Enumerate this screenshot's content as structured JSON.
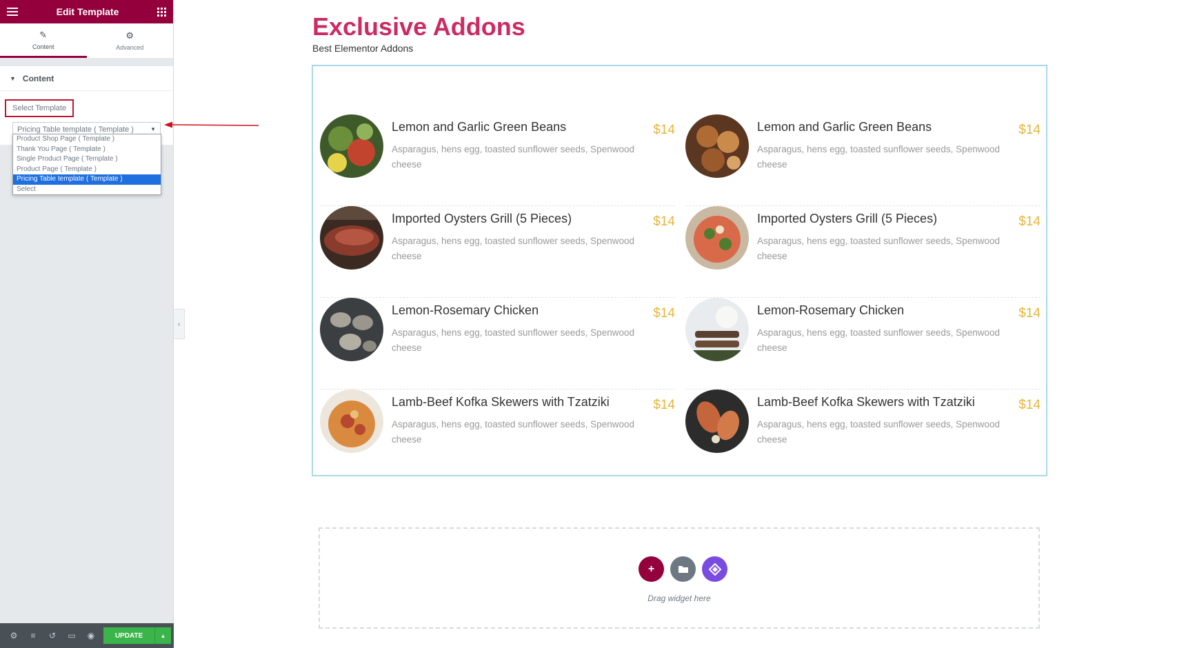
{
  "panel": {
    "title": "Edit Template",
    "tabs": [
      {
        "label": "Content",
        "icon": "pencil-icon"
      },
      {
        "label": "Advanced",
        "icon": "gear-icon"
      }
    ],
    "section_title": "Content",
    "control_label": "Select Template",
    "selected_value": "Pricing Table template ( Template )",
    "options": [
      "Product Shop Page ( Template )",
      "Thank You Page ( Template )",
      "Single Product Page ( Template )",
      "Product Page ( Template )",
      "Pricing Table template ( Template )",
      "Select"
    ],
    "footer": {
      "update_label": "UPDATE"
    }
  },
  "page": {
    "heading": "Exclusive Addons",
    "subheading": "Best Elementor Addons"
  },
  "menu": {
    "items": [
      {
        "title": "Lemon and Garlic Green Beans",
        "price": "$14",
        "desc": "Asparagus, hens egg, toasted sunflower seeds, Spenwood cheese"
      },
      {
        "title": "Lemon and Garlic Green Beans",
        "price": "$14",
        "desc": "Asparagus, hens egg, toasted sunflower seeds, Spenwood cheese"
      },
      {
        "title": "Imported Oysters Grill (5 Pieces)",
        "price": "$14",
        "desc": "Asparagus, hens egg, toasted sunflower seeds, Spenwood cheese"
      },
      {
        "title": "Imported Oysters Grill (5 Pieces)",
        "price": "$14",
        "desc": "Asparagus, hens egg, toasted sunflower seeds, Spenwood cheese"
      },
      {
        "title": "Lemon-Rosemary Chicken",
        "price": "$14",
        "desc": "Asparagus, hens egg, toasted sunflower seeds, Spenwood cheese"
      },
      {
        "title": "Lemon-Rosemary Chicken",
        "price": "$14",
        "desc": "Asparagus, hens egg, toasted sunflower seeds, Spenwood cheese"
      },
      {
        "title": "Lamb-Beef Kofka Skewers with Tzatziki",
        "price": "$14",
        "desc": "Asparagus, hens egg, toasted sunflower seeds, Spenwood cheese"
      },
      {
        "title": "Lamb-Beef Kofka Skewers with Tzatziki",
        "price": "$14",
        "desc": "Asparagus, hens egg, toasted sunflower seeds, Spenwood cheese"
      }
    ]
  },
  "drop_zone": {
    "label": "Drag widget here"
  },
  "colors": {
    "brand": "#93003c",
    "heading": "#cc2b62",
    "price": "#e5b63c",
    "update": "#39b54a",
    "selected_option": "#1e6fe0"
  }
}
